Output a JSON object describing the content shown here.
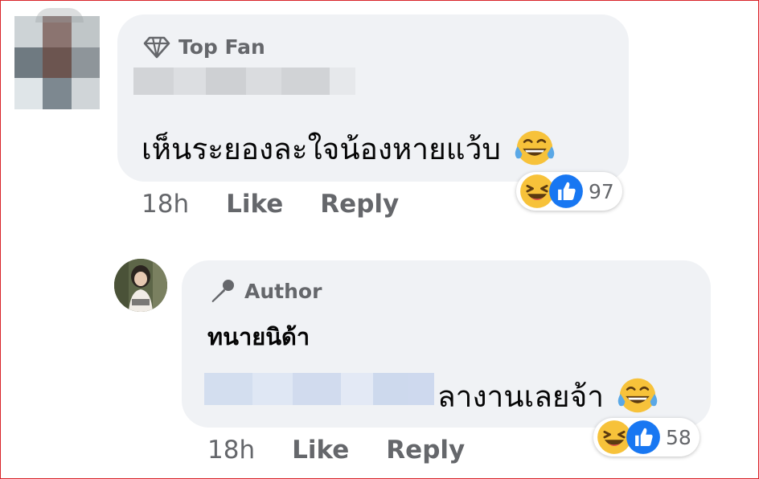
{
  "comment": {
    "badge": "Top Fan",
    "badge_icon": "diamond-icon",
    "text": "เห็นระยองละใจน้องหายแว้บ",
    "emoji": "laughing-tears-emoji",
    "time": "18h",
    "like_label": "Like",
    "reply_label": "Reply",
    "reactions": {
      "icons": [
        "haha-reaction-icon",
        "like-reaction-icon"
      ],
      "count": "97"
    }
  },
  "reply": {
    "badge": "Author",
    "badge_icon": "microphone-icon",
    "author": "ทนายนิด้า",
    "text": "ลางานเลยจ้า",
    "emoji": "laughing-tears-emoji",
    "time": "18h",
    "like_label": "Like",
    "reply_label": "Reply",
    "reactions": {
      "icons": [
        "haha-reaction-icon",
        "like-reaction-icon"
      ],
      "count": "58"
    }
  },
  "colors": {
    "bubble": "#f0f2f5",
    "meta_text": "#65676b",
    "like_blue": "#1877f2",
    "haha_yellow": "#f7c23a",
    "frame_red": "#d9242a"
  }
}
